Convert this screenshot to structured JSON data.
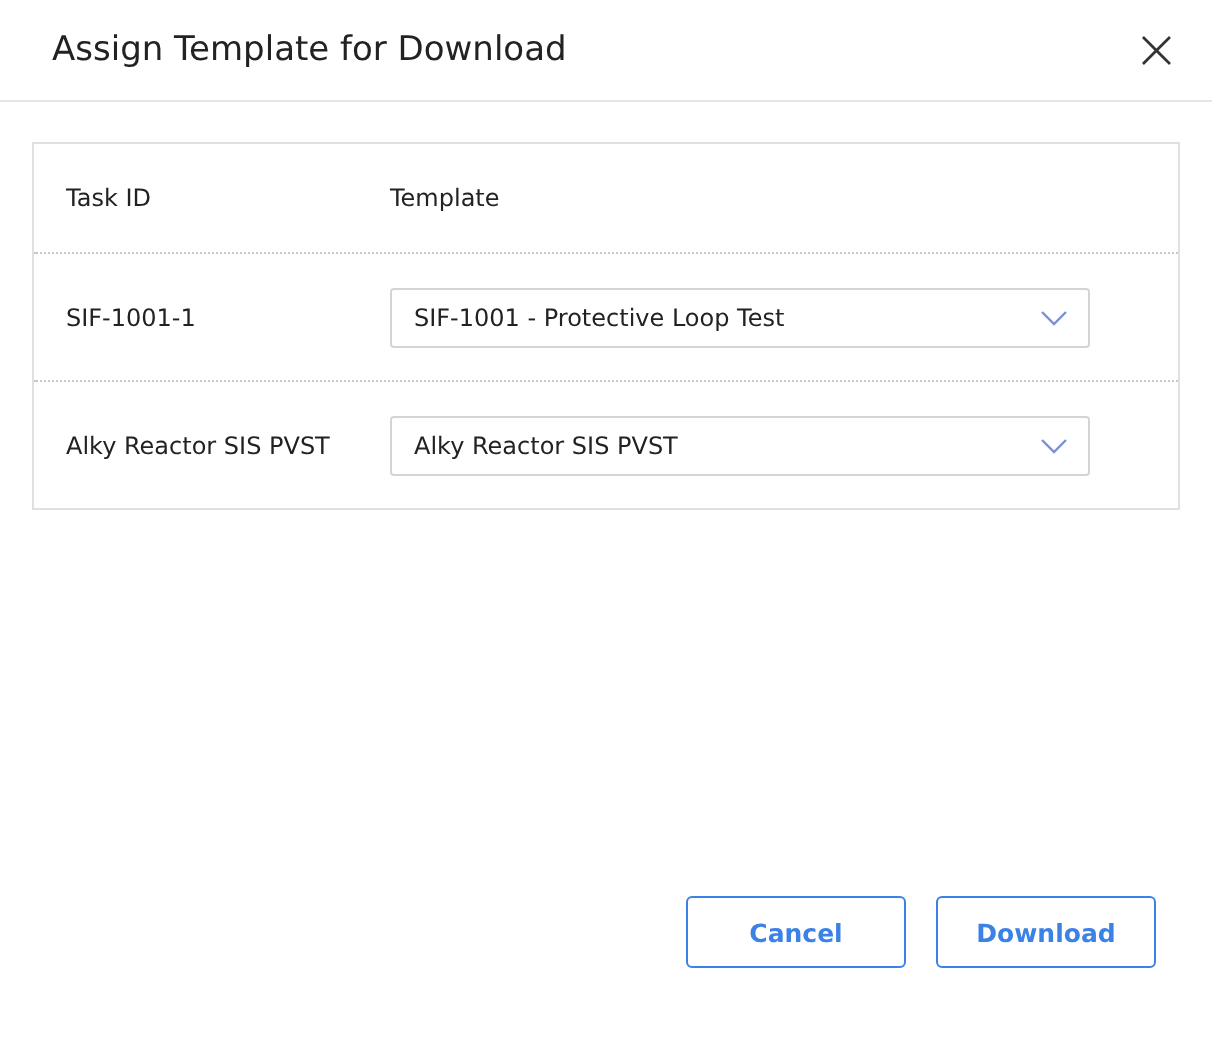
{
  "dialog": {
    "title": "Assign Template for Download",
    "close": "×"
  },
  "table": {
    "columns": [
      "Task ID",
      "Template"
    ],
    "rows": [
      {
        "task_id": "SIF-1001-1",
        "template": "SIF-1001 - Protective Loop Test"
      },
      {
        "task_id": "Alky Reactor SIS PVST",
        "template": "Alky Reactor SIS PVST"
      }
    ]
  },
  "buttons": [
    {
      "label": "Cancel"
    },
    {
      "label": "Download"
    }
  ]
}
